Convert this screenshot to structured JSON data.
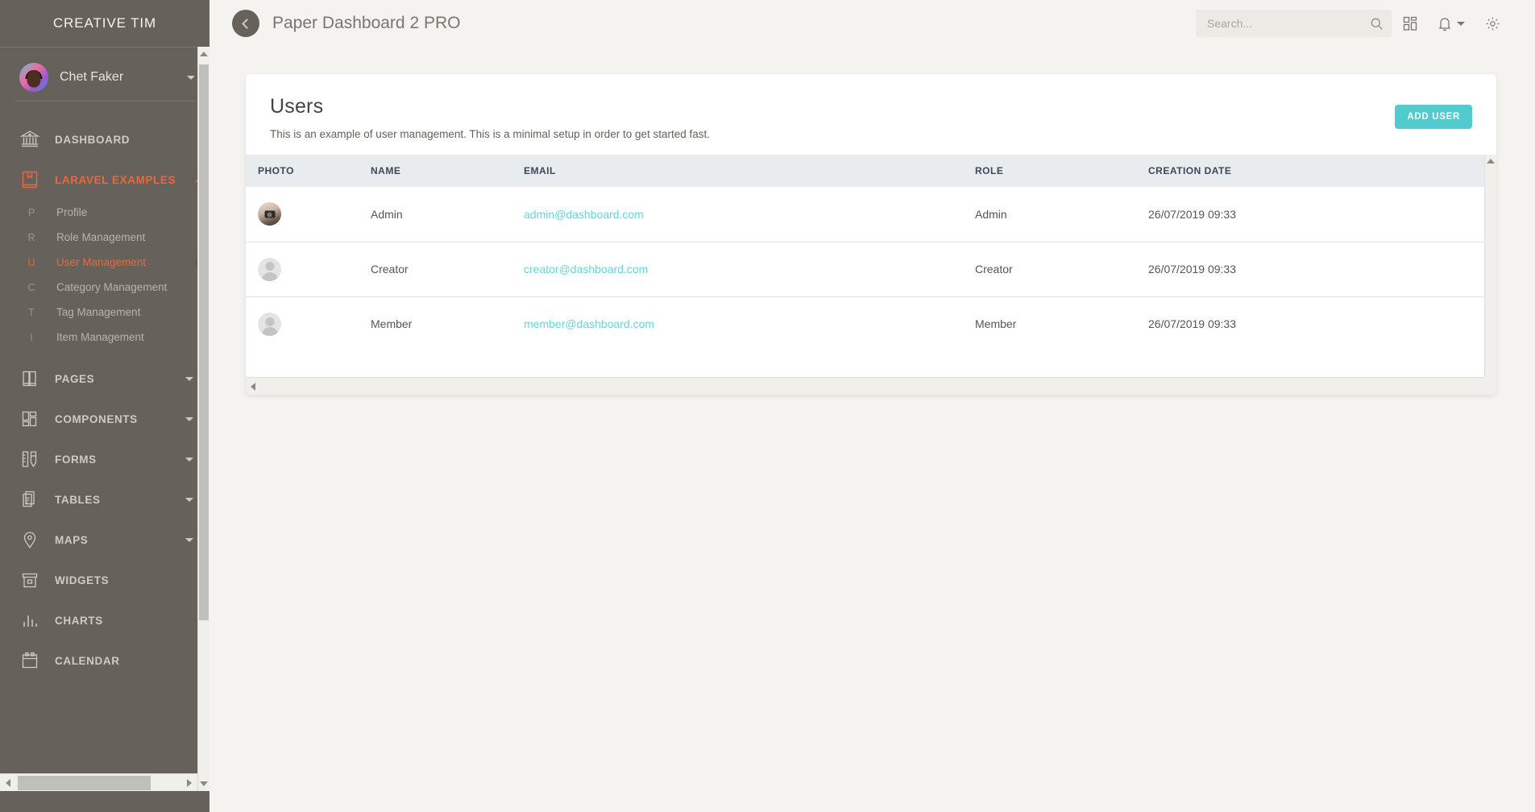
{
  "brand": {
    "title": "CREATIVE TIM"
  },
  "user": {
    "name": "Chet Faker",
    "avatar_icon": "user-avatar-image",
    "caret_icon": "chevron-down-icon"
  },
  "sidebar": {
    "items": [
      {
        "label": "DASHBOARD",
        "icon": "bank-icon",
        "has_caret": false,
        "active": false
      },
      {
        "label": "LARAVEL EXAMPLES",
        "icon": "bookmark-book-icon",
        "has_caret": true,
        "caret": "chevron-up-icon",
        "active": true
      }
    ],
    "sub_items": [
      {
        "mini": "P",
        "label": "Profile",
        "active": false
      },
      {
        "mini": "R",
        "label": "Role Management",
        "active": false
      },
      {
        "mini": "U",
        "label": "User Management",
        "active": true
      },
      {
        "mini": "C",
        "label": "Category Management",
        "active": false
      },
      {
        "mini": "T",
        "label": "Tag Management",
        "active": false
      },
      {
        "mini": "I",
        "label": "Item Management",
        "active": false
      }
    ],
    "items_after": [
      {
        "label": "PAGES",
        "icon": "book-icon",
        "has_caret": true
      },
      {
        "label": "COMPONENTS",
        "icon": "layout-grid-icon",
        "has_caret": true
      },
      {
        "label": "FORMS",
        "icon": "ruler-pencil-icon",
        "has_caret": true
      },
      {
        "label": "TABLES",
        "icon": "documents-icon",
        "has_caret": true
      },
      {
        "label": "MAPS",
        "icon": "map-pin-icon",
        "has_caret": true
      },
      {
        "label": "WIDGETS",
        "icon": "box-icon",
        "has_caret": false
      },
      {
        "label": "CHARTS",
        "icon": "bar-chart-icon",
        "has_caret": false
      },
      {
        "label": "CALENDAR",
        "icon": "calendar-icon",
        "has_caret": false
      }
    ]
  },
  "navbar": {
    "back_icon": "chevron-left-icon",
    "title": "Paper Dashboard 2 PRO",
    "search_placeholder": "Search...",
    "search_value": "",
    "search_icon": "search-icon",
    "apps_icon": "grid-apps-icon",
    "bell_icon": "bell-icon",
    "bell_caret_icon": "chevron-down-icon",
    "settings_icon": "gear-icon"
  },
  "card": {
    "title": "Users",
    "subtitle": "This is an example of user management. This is a minimal setup in order to get started fast.",
    "add_user_label": "ADD USER"
  },
  "table": {
    "columns": [
      "PHOTO",
      "NAME",
      "EMAIL",
      "ROLE",
      "CREATION DATE"
    ],
    "rows": [
      {
        "photo": "user-photo-avatar",
        "name": "Admin",
        "email": "admin@dashboard.com",
        "role": "Admin",
        "created": "26/07/2019 09:33"
      },
      {
        "photo": "placeholder-avatar",
        "name": "Creator",
        "email": "creator@dashboard.com",
        "role": "Creator",
        "created": "26/07/2019 09:33"
      },
      {
        "photo": "placeholder-avatar",
        "name": "Member",
        "email": "member@dashboard.com",
        "role": "Member",
        "created": "26/07/2019 09:33"
      }
    ]
  },
  "colors": {
    "sidebar_bg": "#66615b",
    "page_bg": "#f4f3ef",
    "accent_orange": "#f0663a",
    "accent_teal": "#51cbce",
    "email_link": "#68d4dd",
    "table_head_bg": "#e8ecef"
  }
}
